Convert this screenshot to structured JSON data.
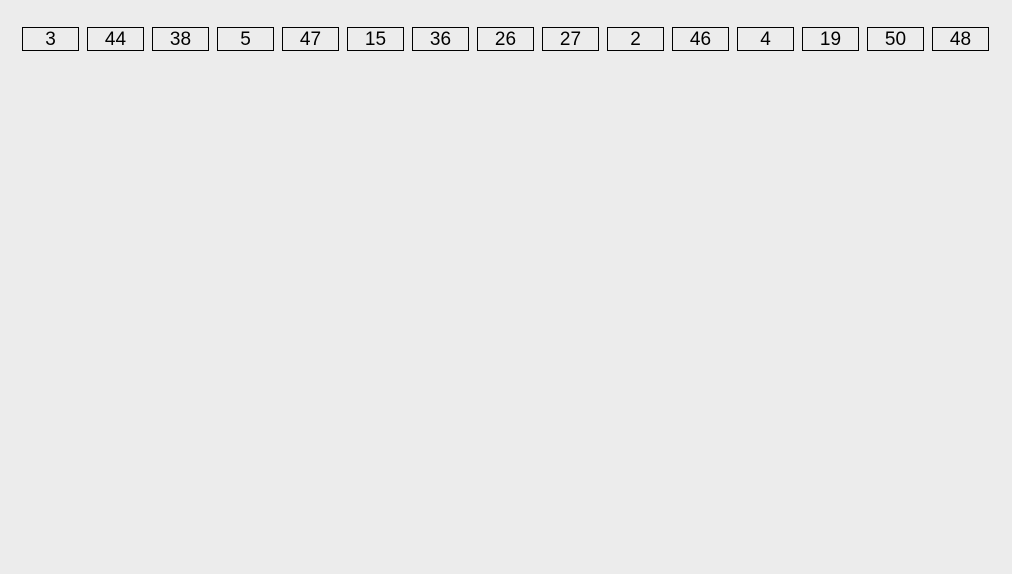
{
  "row": {
    "items": [
      {
        "label": "3"
      },
      {
        "label": "44"
      },
      {
        "label": "38"
      },
      {
        "label": "5"
      },
      {
        "label": "47"
      },
      {
        "label": "15"
      },
      {
        "label": "36"
      },
      {
        "label": "26"
      },
      {
        "label": "27"
      },
      {
        "label": "2"
      },
      {
        "label": "46"
      },
      {
        "label": "4"
      },
      {
        "label": "19"
      },
      {
        "label": "50"
      },
      {
        "label": "48"
      }
    ]
  }
}
